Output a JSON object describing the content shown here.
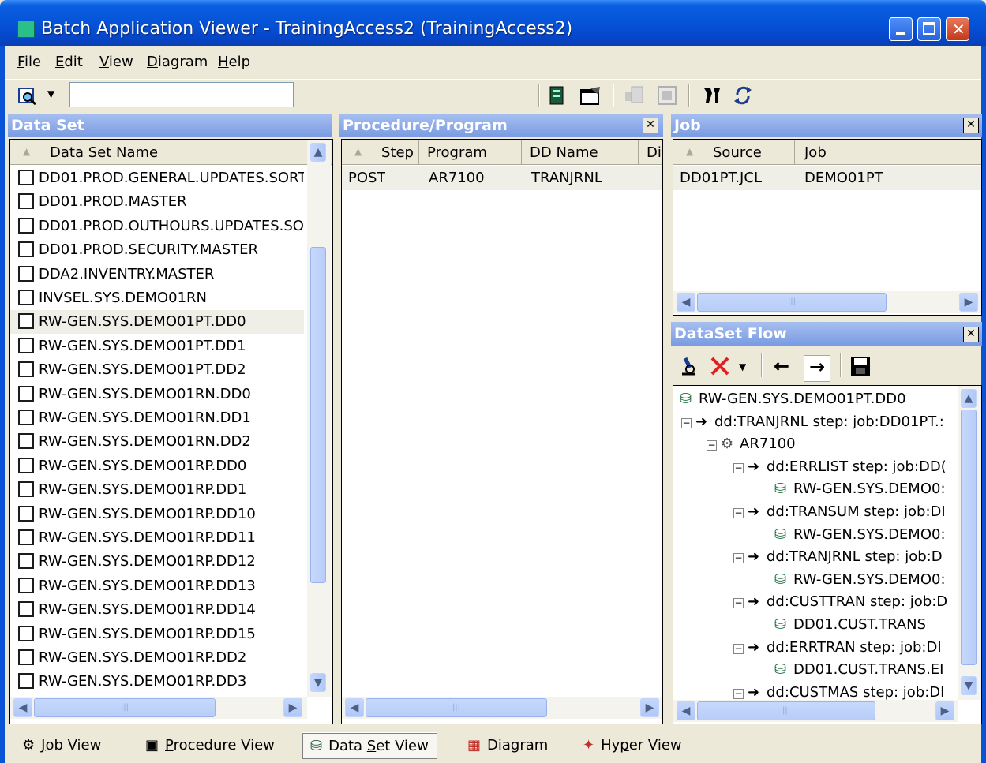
{
  "window": {
    "title": "Batch Application Viewer - TrainingAccess2 (TrainingAccess2)",
    "buttons": {
      "minimize": "_",
      "maximize": "□",
      "close": "✕"
    }
  },
  "menu": {
    "items": [
      {
        "accel": "F",
        "rest": "ile"
      },
      {
        "accel": "E",
        "rest": "dit"
      },
      {
        "accel": "V",
        "rest": "iew"
      },
      {
        "accel": "D",
        "rest": "iagram"
      },
      {
        "accel": "H",
        "rest": "elp"
      }
    ]
  },
  "toolbar": {
    "search_value": "",
    "icons": [
      "find-icon",
      "dropdown-arrow-icon",
      "book-icon",
      "properties-icon",
      "expand-icon",
      "fit-icon",
      "tools-icon",
      "refresh-icon"
    ]
  },
  "dataset_panel": {
    "title": "Data Set",
    "column": "Data Set Name",
    "rows": [
      "DD01.PROD.GENERAL.UPDATES.SORT",
      "DD01.PROD.MASTER",
      "DD01.PROD.OUTHOURS.UPDATES.SOR",
      "DD01.PROD.SECURITY.MASTER",
      "DDA2.INVENTRY.MASTER",
      "INVSEL.SYS.DEMO01RN",
      "RW-GEN.SYS.DEMO01PT.DD0",
      "RW-GEN.SYS.DEMO01PT.DD1",
      "RW-GEN.SYS.DEMO01PT.DD2",
      "RW-GEN.SYS.DEMO01RN.DD0",
      "RW-GEN.SYS.DEMO01RN.DD1",
      "RW-GEN.SYS.DEMO01RN.DD2",
      "RW-GEN.SYS.DEMO01RP.DD0",
      "RW-GEN.SYS.DEMO01RP.DD1",
      "RW-GEN.SYS.DEMO01RP.DD10",
      "RW-GEN.SYS.DEMO01RP.DD11",
      "RW-GEN.SYS.DEMO01RP.DD12",
      "RW-GEN.SYS.DEMO01RP.DD13",
      "RW-GEN.SYS.DEMO01RP.DD14",
      "RW-GEN.SYS.DEMO01RP.DD15",
      "RW-GEN.SYS.DEMO01RP.DD2",
      "RW-GEN.SYS.DEMO01RP.DD3"
    ],
    "selected_index": 6
  },
  "procedure_panel": {
    "title": "Procedure/Program",
    "columns": [
      "Step",
      "Program",
      "DD Name",
      "Di"
    ],
    "rows": [
      {
        "step": "POST",
        "program": "AR7100",
        "dd_name": "TRANJRNL"
      }
    ]
  },
  "job_panel": {
    "title": "Job",
    "columns": [
      "Source",
      "Job"
    ],
    "rows": [
      {
        "source": "DD01PT.JCL",
        "job": "DEMO01PT"
      }
    ]
  },
  "flow_panel": {
    "title": "DataSet Flow",
    "tree": [
      {
        "text": "RW-GEN.SYS.DEMO01PT.DD0",
        "kind": "dataset"
      },
      {
        "text": "dd:TRANJRNL step: job:DD01PT.:",
        "kind": "dd"
      },
      {
        "text": "AR7100",
        "kind": "program"
      },
      {
        "text": "dd:ERRLIST step: job:DD(",
        "kind": "dd"
      },
      {
        "text": "RW-GEN.SYS.DEMO0:",
        "kind": "dataset"
      },
      {
        "text": "dd:TRANSUM step: job:DI",
        "kind": "dd"
      },
      {
        "text": "RW-GEN.SYS.DEMO0:",
        "kind": "dataset"
      },
      {
        "text": "dd:TRANJRNL step: job:D",
        "kind": "dd"
      },
      {
        "text": "RW-GEN.SYS.DEMO0:",
        "kind": "dataset"
      },
      {
        "text": "dd:CUSTTRAN step: job:D",
        "kind": "dd"
      },
      {
        "text": "DD01.CUST.TRANS",
        "kind": "dataset"
      },
      {
        "text": "dd:ERRTRAN step: job:DI",
        "kind": "dd"
      },
      {
        "text": "DD01.CUST.TRANS.EI",
        "kind": "dataset"
      },
      {
        "text": "dd:CUSTMAS step: job:DI",
        "kind": "dd"
      }
    ]
  },
  "views": [
    {
      "accel": "J",
      "label_pre": "",
      "label_rest": "ob View",
      "icon": "gears-icon"
    },
    {
      "accel": "P",
      "label_pre": "",
      "label_rest": "rocedure View",
      "icon": "procedure-icon"
    },
    {
      "accel": "S",
      "label_pre": "Data ",
      "label_rest": "et View",
      "icon": "dataset-icon",
      "active": true
    },
    {
      "accel": "",
      "label_pre": "Diagram",
      "label_rest": "",
      "icon": "diagram-icon"
    },
    {
      "accel": "p",
      "label_pre": "Hy",
      "label_rest": "er View",
      "icon": "hyper-icon"
    }
  ]
}
